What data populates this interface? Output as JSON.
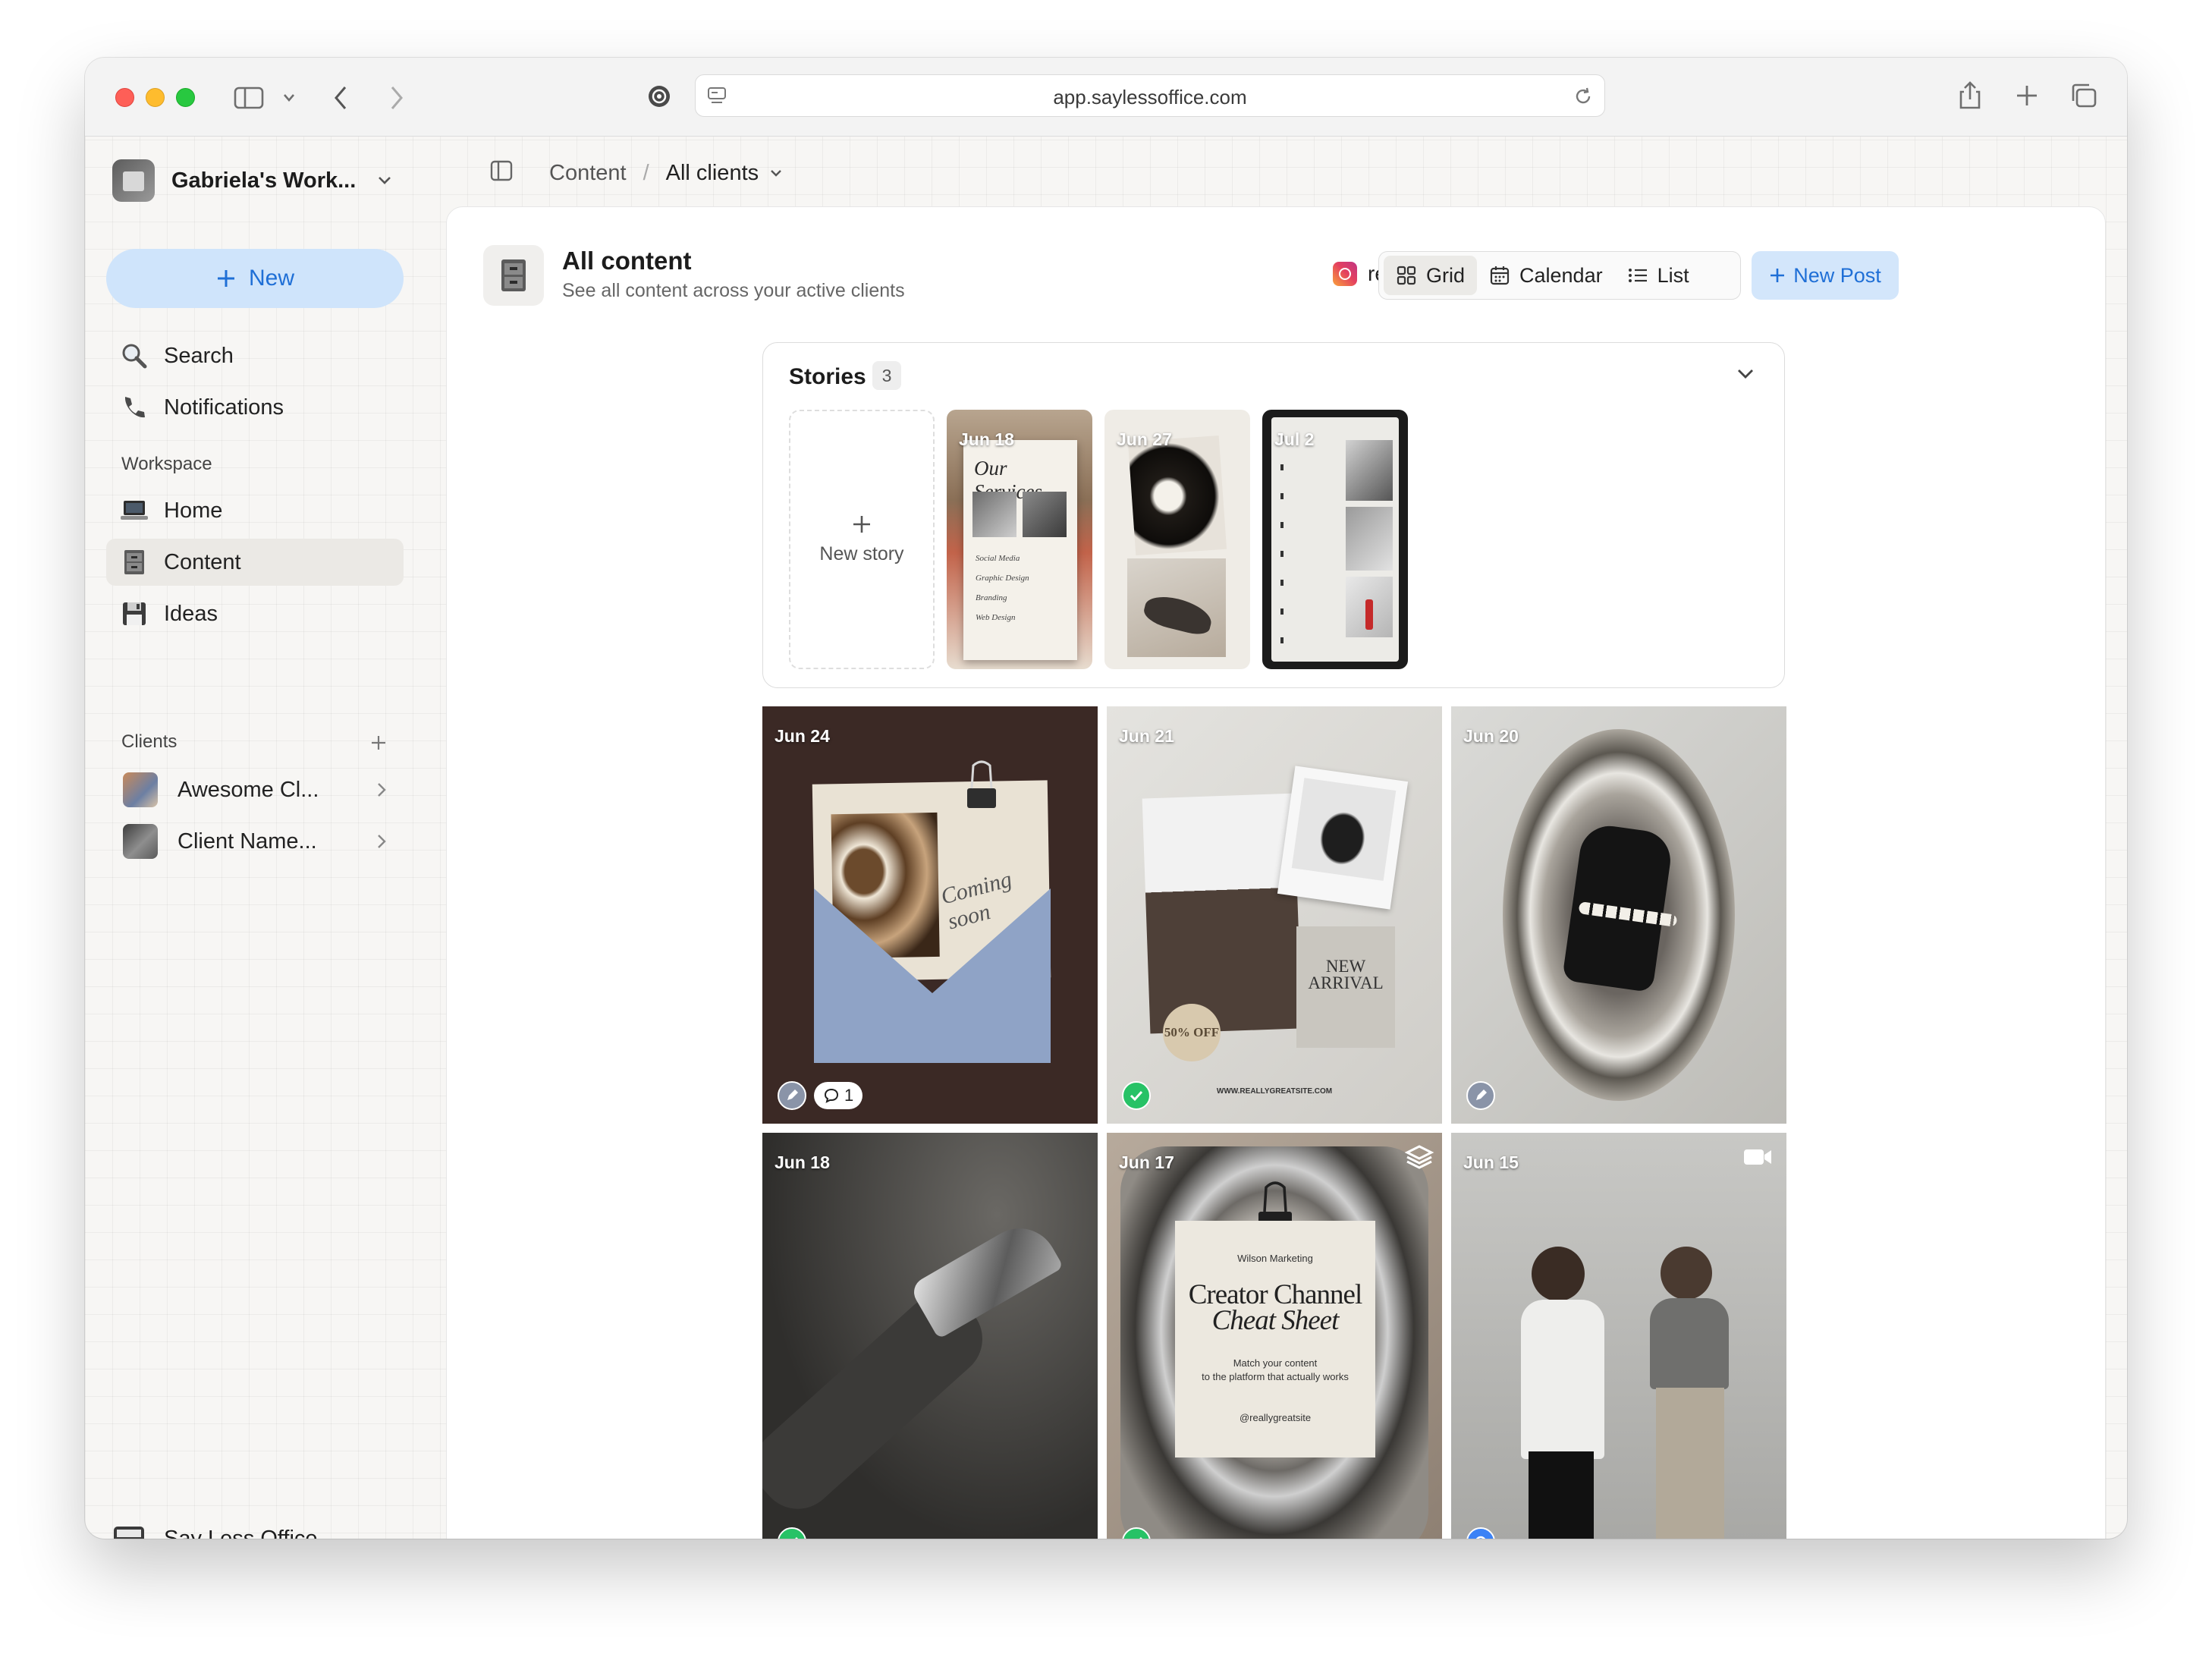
{
  "browser": {
    "url": "app.saylessoffice.com"
  },
  "sidebar": {
    "workspace_name": "Gabriela's Work...",
    "new_button_label": "New",
    "nav_top": [
      {
        "label": "Search",
        "icon": "search-icon"
      },
      {
        "label": "Notifications",
        "icon": "phone-icon"
      }
    ],
    "workspace_section_label": "Workspace",
    "workspace_items": [
      {
        "label": "Home",
        "icon": "laptop-icon"
      },
      {
        "label": "Content",
        "icon": "cabinet-icon",
        "active": true
      },
      {
        "label": "Ideas",
        "icon": "floppy-icon"
      }
    ],
    "clients_section_label": "Clients",
    "clients": [
      {
        "label": "Awesome Cl..."
      },
      {
        "label": "Client Name..."
      }
    ],
    "brand": "Say Less Office."
  },
  "breadcrumb": {
    "root": "Content",
    "separator": "/",
    "current": "All clients"
  },
  "page": {
    "title": "All content",
    "subtitle": "See all content across your active clients",
    "account": "reallygreatig",
    "views": [
      "Grid",
      "Calendar",
      "List"
    ],
    "active_view": "Grid",
    "new_post_label": "New Post"
  },
  "stories": {
    "title": "Stories",
    "count": "3",
    "new_story_label": "New story",
    "items": [
      {
        "date": "Jun 18",
        "headline": "Our Services",
        "lines": [
          "Social Media",
          "Graphic Design",
          "Branding",
          "Web Design"
        ]
      },
      {
        "date": "Jun 27"
      },
      {
        "date": "Jul 2"
      }
    ]
  },
  "posts": [
    {
      "date": "Jun 24",
      "status": "draft",
      "comments": "1",
      "script_text": "Coming soon"
    },
    {
      "date": "Jun 21",
      "status": "published",
      "paper_title": "NEW ARRIVAL",
      "badge": "50% OFF",
      "footer": "WWW.REALLYGREATSITE.COM"
    },
    {
      "date": "Jun 20",
      "status": "draft"
    },
    {
      "date": "Jun 18",
      "status": "published"
    },
    {
      "date": "Jun 17",
      "status": "published",
      "card_kicker": "Wilson Marketing",
      "card_title_1": "Creator Channel",
      "card_title_2": "Cheat Sheet",
      "card_body_1": "Match your content",
      "card_body_2": "to the platform that actually works",
      "card_handle": "@reallygreatsite"
    },
    {
      "date": "Jun 15",
      "status": "scheduled"
    }
  ],
  "colors": {
    "accent": "#1f6fd6",
    "accent_bg": "#cfe4fb",
    "published": "#27c266",
    "draft": "#8a94a8"
  }
}
